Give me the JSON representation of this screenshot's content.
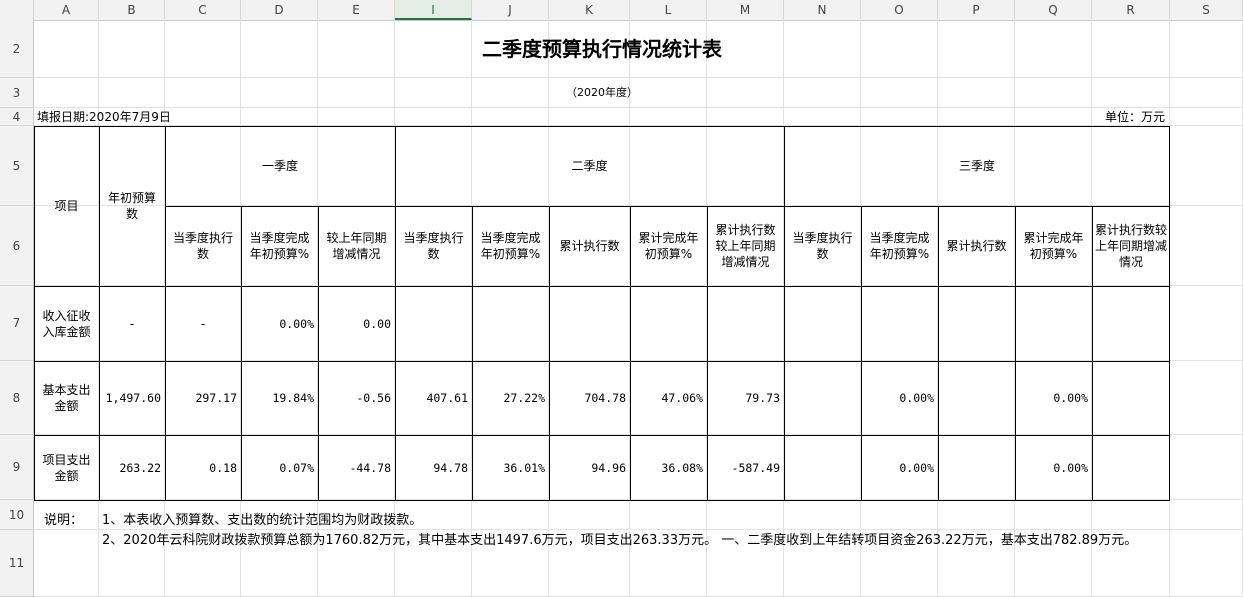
{
  "columns": [
    "A",
    "B",
    "C",
    "D",
    "E",
    "I",
    "J",
    "K",
    "L",
    "M",
    "N",
    "O",
    "P",
    "Q",
    "R",
    "S"
  ],
  "selected_column": "I",
  "rows": [
    "2",
    "3",
    "4",
    "5",
    "6",
    "7",
    "8",
    "9",
    "10",
    "11"
  ],
  "title": "二季度预算执行情况统计表",
  "subtitle": "（2020年度）",
  "fill_date": "填报日期:2020年7月9日",
  "unit": "单位：万元",
  "headers": {
    "item": "项目",
    "annual_budget": "年初预算数",
    "q1": "一季度",
    "q2": "二季度",
    "q3": "三季度",
    "q1_cols": [
      "当季度执行数",
      "当季度完成年初预算%",
      "较上年同期增减情况"
    ],
    "q2_cols": [
      "当季度执行数",
      "当季度完成年初预算%",
      "累计执行数",
      "累计完成年初预算%",
      "累计执行数较上年同期增减情况"
    ],
    "q3_cols": [
      "当季度执行数",
      "当季度完成年初预算%",
      "累计执行数",
      "累计完成年初预算%",
      "累计执行数较上年同期增减情况"
    ]
  },
  "data_rows": [
    {
      "label": "收入征收入库金额",
      "values": [
        "-",
        "-",
        "0.00%",
        "0.00",
        "",
        "",
        "",
        "",
        "",
        "",
        "",
        "",
        "",
        ""
      ]
    },
    {
      "label": "基本支出金额",
      "values": [
        "1,497.60",
        "297.17",
        "19.84%",
        "-0.56",
        "407.61",
        "27.22%",
        "704.78",
        "47.06%",
        "79.73",
        "",
        "0.00%",
        "",
        "0.00%",
        ""
      ]
    },
    {
      "label": "项目支出金额",
      "values": [
        "263.22",
        "0.18",
        "0.07%",
        "-44.78",
        "94.78",
        "36.01%",
        "94.96",
        "36.08%",
        "-587.49",
        "",
        "0.00%",
        "",
        "0.00%",
        ""
      ]
    }
  ],
  "notes": {
    "label": "说明：",
    "line1": "1、本表收入预算数、支出数的统计范围均为财政拨款。",
    "line2": "2、2020年云科院财政拨款预算总额为1760.82万元，其中基本支出1497.6万元，项目支出263.33万元。 一、二季度收到上年结转项目资金263.22万元，基本支出782.89万元。"
  }
}
